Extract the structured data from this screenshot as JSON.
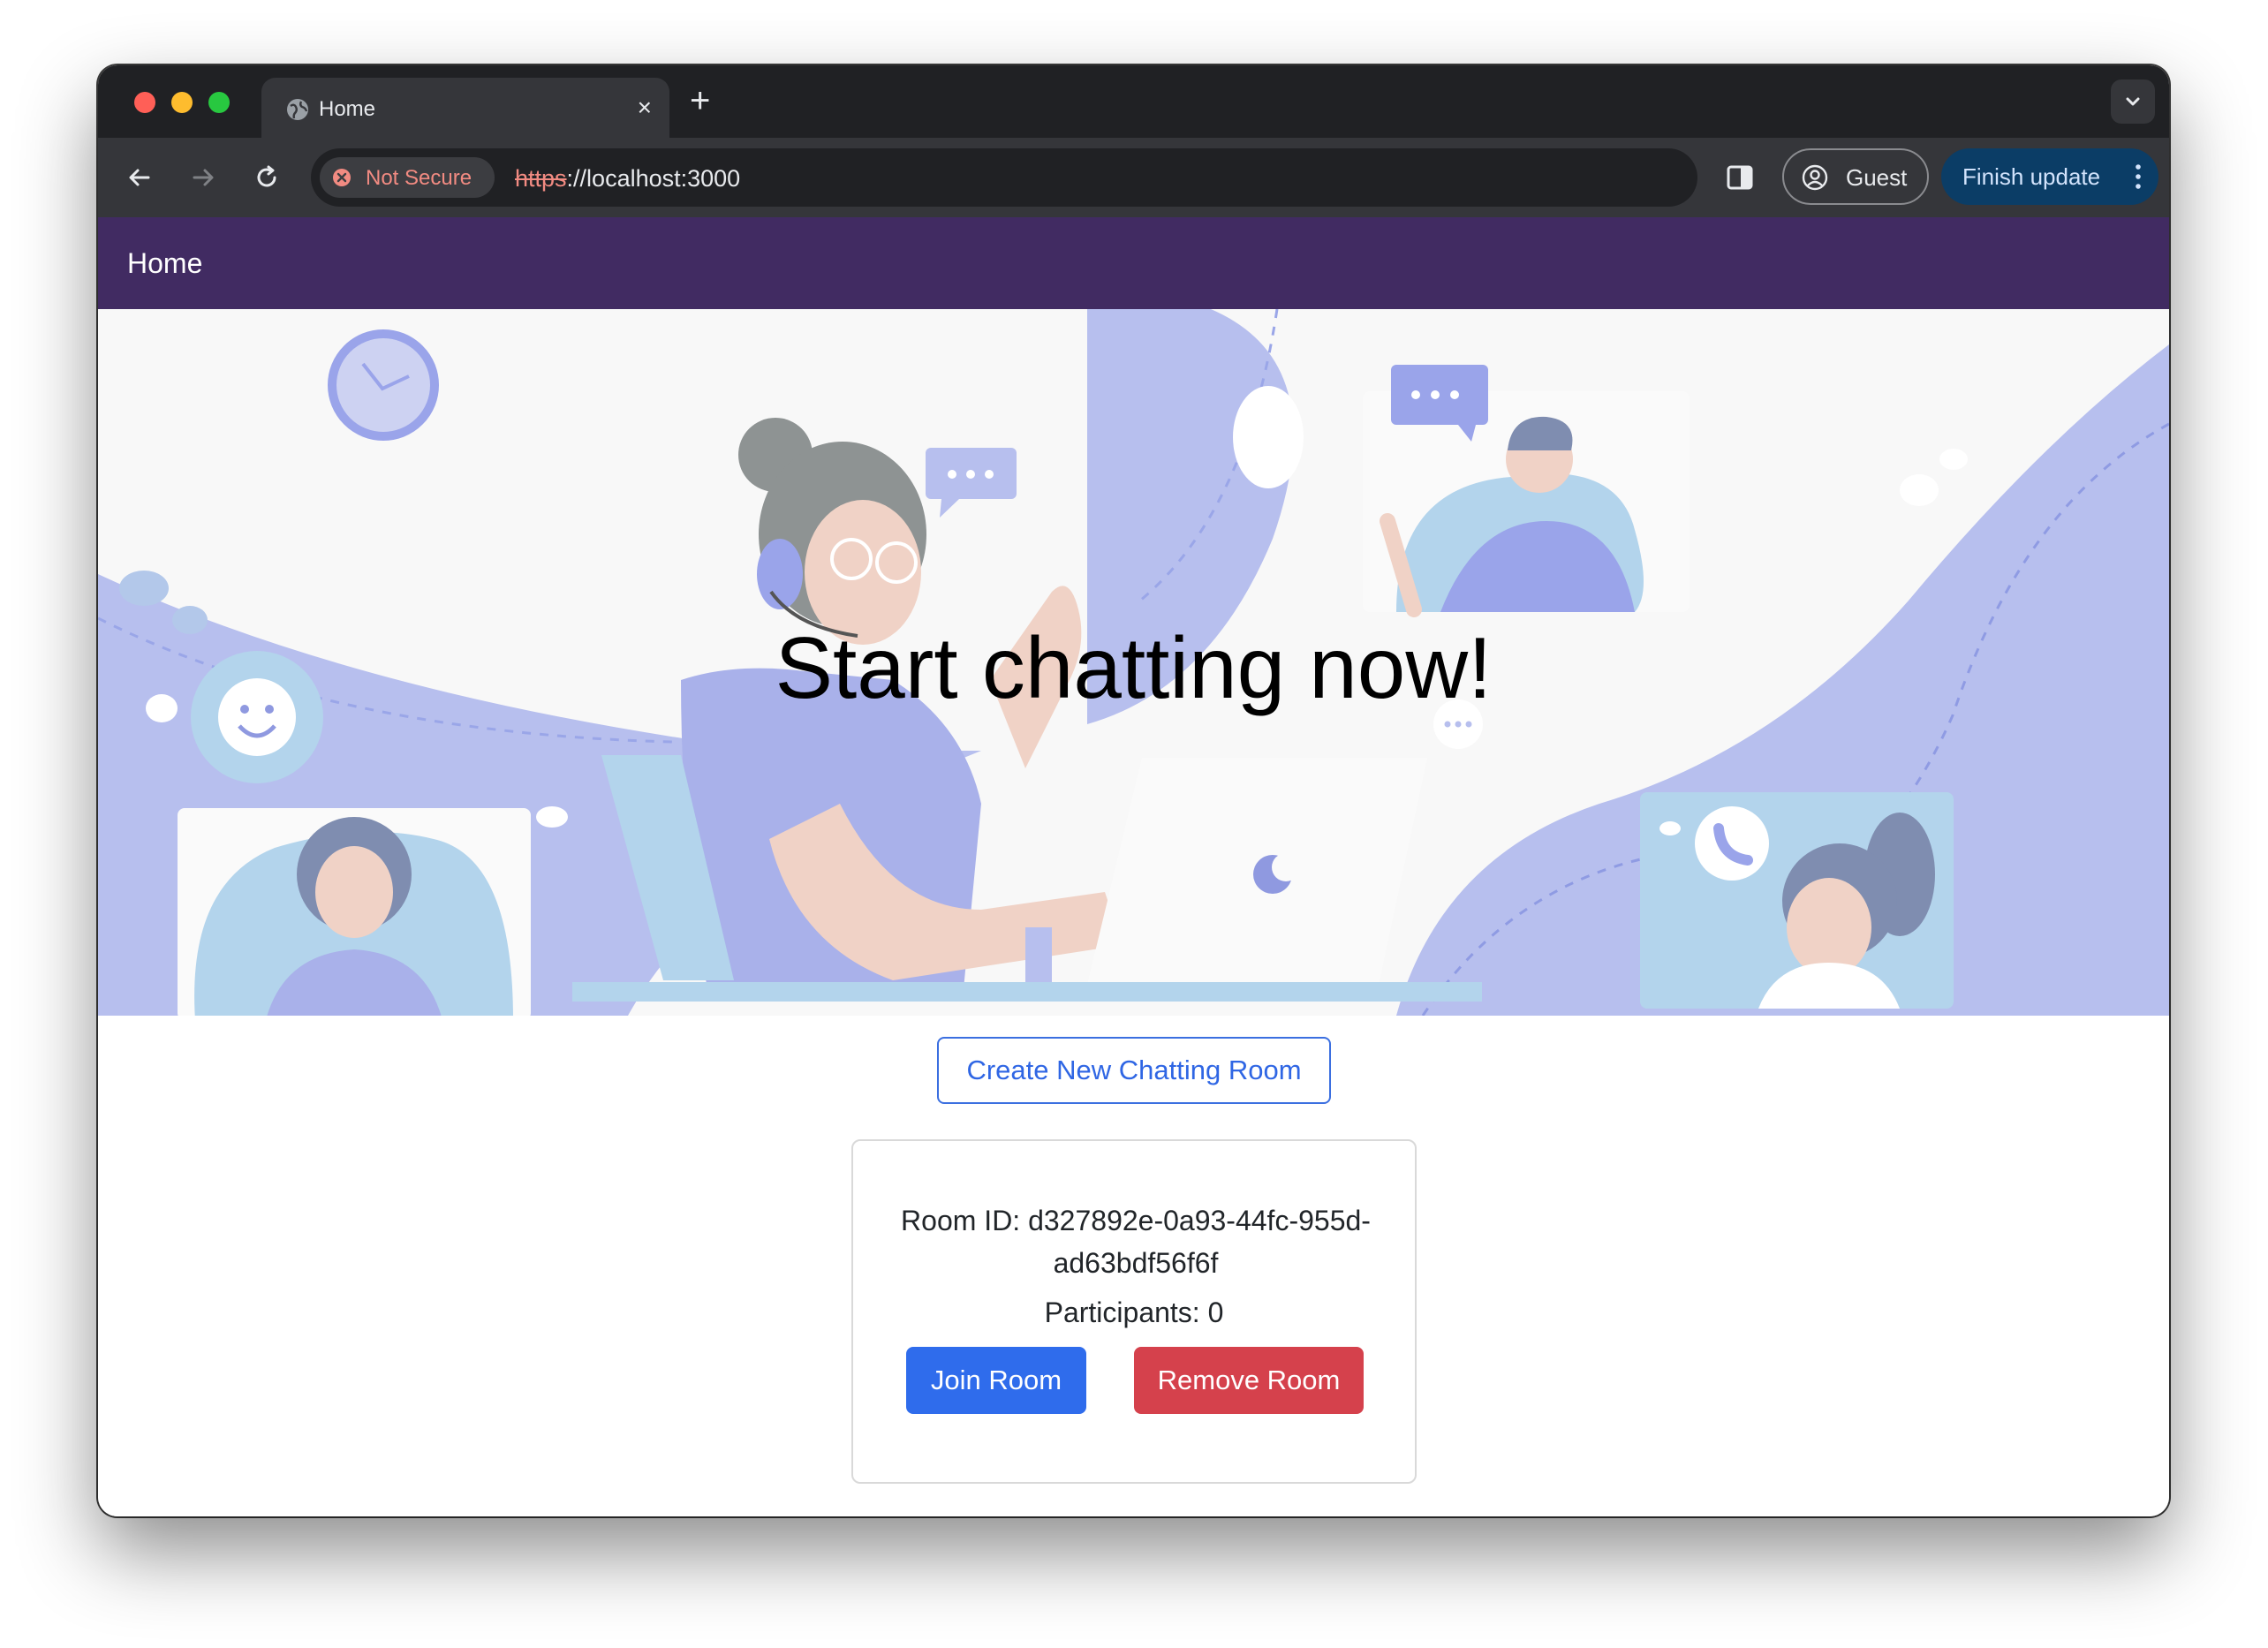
{
  "browser": {
    "tab": {
      "title": "Home",
      "close_glyph": "×"
    },
    "new_tab_glyph": "+",
    "security_chip": {
      "label": "Not Secure"
    },
    "url": {
      "scheme": "https",
      "rest": "://localhost:3000"
    },
    "profile": {
      "label": "Guest"
    },
    "update_button": {
      "label": "Finish update"
    }
  },
  "navbar": {
    "brand": "Home"
  },
  "hero": {
    "title": "Start chatting now!"
  },
  "actions": {
    "create_room": "Create New Chatting Room"
  },
  "room": {
    "id_line": "Room ID: d327892e-0a93-44fc-955d-ad63bdf56f6f",
    "participants_line": "Participants: 0",
    "join_label": "Join Room",
    "remove_label": "Remove Room"
  },
  "colors": {
    "navbar": "#412b62",
    "primary": "#2f6cec",
    "danger": "#d5414c",
    "hero_illustration": "#b7bfee"
  },
  "icons": [
    "globe-icon",
    "close-icon",
    "plus-icon",
    "chevron-down-icon",
    "back-arrow-icon",
    "forward-arrow-icon",
    "reload-icon",
    "not-secure-icon",
    "side-panel-icon",
    "account-icon",
    "more-vert-icon"
  ]
}
